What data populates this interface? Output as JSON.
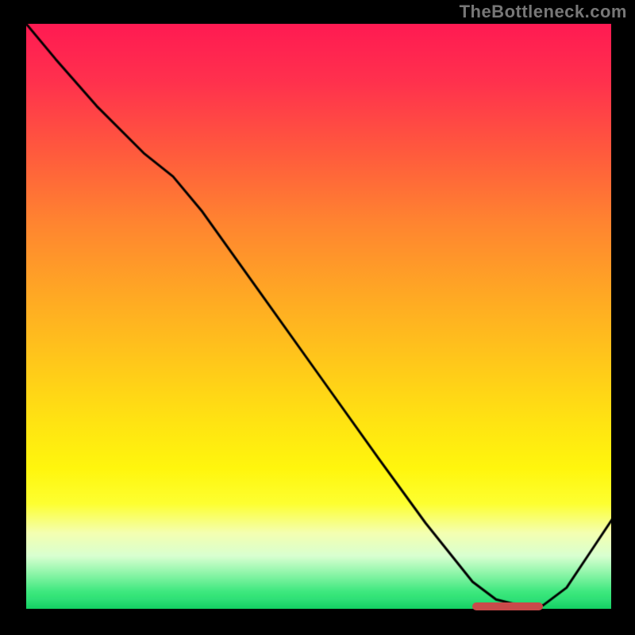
{
  "attribution": "TheBottleneck.com",
  "colors": {
    "background": "#000000",
    "curve": "#000000",
    "marker": "#c94a4a"
  },
  "chart_data": {
    "type": "line",
    "title": "",
    "xlabel": "",
    "ylabel": "",
    "xlim": [
      0,
      100
    ],
    "ylim": [
      0,
      100
    ],
    "grid": false,
    "legend": false,
    "series": [
      {
        "name": "bottleneck-curve",
        "x": [
          0,
          5,
          12,
          20,
          25,
          30,
          40,
          50,
          60,
          68,
          72,
          76,
          80,
          84,
          88,
          92,
          96,
          100
        ],
        "y": [
          100,
          94,
          86,
          78,
          74,
          68,
          54,
          40,
          26,
          15,
          10,
          5,
          2,
          1,
          1,
          4,
          10,
          16
        ]
      }
    ],
    "marker_segment": {
      "x_start": 76,
      "x_end": 88,
      "y": 0.8
    },
    "gradient_stops": [
      {
        "pct": 0,
        "hex": "#ff1a52"
      },
      {
        "pct": 10,
        "hex": "#ff314d"
      },
      {
        "pct": 22,
        "hex": "#ff5a3d"
      },
      {
        "pct": 34,
        "hex": "#ff8430"
      },
      {
        "pct": 46,
        "hex": "#ffa724"
      },
      {
        "pct": 58,
        "hex": "#ffc81a"
      },
      {
        "pct": 68,
        "hex": "#ffe312"
      },
      {
        "pct": 76,
        "hex": "#fff60d"
      },
      {
        "pct": 82,
        "hex": "#fdff30"
      },
      {
        "pct": 87,
        "hex": "#f4ffb0"
      },
      {
        "pct": 91,
        "hex": "#d8ffd0"
      },
      {
        "pct": 94,
        "hex": "#8cf5a8"
      },
      {
        "pct": 97,
        "hex": "#3fe87f"
      },
      {
        "pct": 100,
        "hex": "#17d964"
      }
    ]
  }
}
